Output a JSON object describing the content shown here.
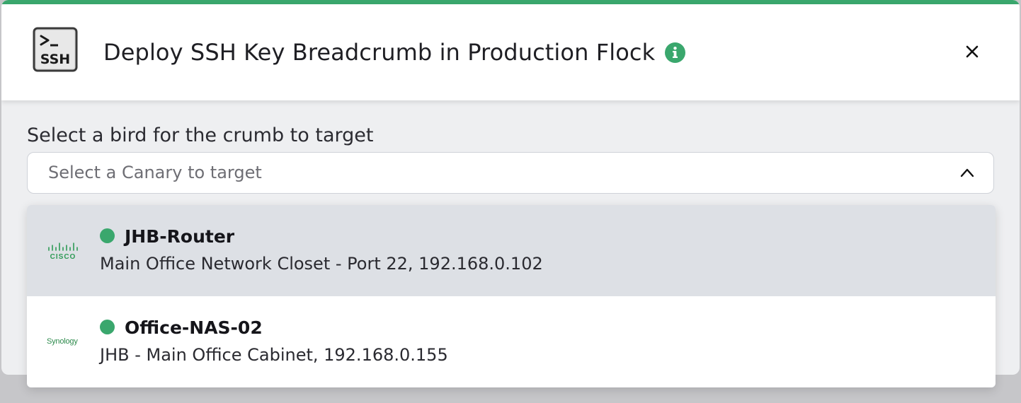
{
  "dialog": {
    "title": "Deploy SSH Key Breadcrumb in Production Flock",
    "logo_text": "SSH",
    "logo_prompt": ">_",
    "info_icon": "info-icon",
    "close_icon": "close-icon"
  },
  "form": {
    "label": "Select a bird for the crumb to target",
    "select": {
      "placeholder": "Select a Canary to target",
      "expanded": true,
      "chevron_icon": "chevron-up-icon"
    }
  },
  "options": [
    {
      "name": "JHB-Router",
      "detail": "Main Office Network Closet - Port 22, 192.168.0.102",
      "vendor": "CISCO",
      "vendor_icon": "cisco-logo",
      "status": "online",
      "highlighted": true
    },
    {
      "name": "Office-NAS-02",
      "detail": "JHB - Main Office Cabinet, 192.168.0.155",
      "vendor": "Synology",
      "vendor_icon": "synology-logo",
      "status": "online",
      "highlighted": false
    }
  ],
  "colors": {
    "accent": "#3aa76d",
    "highlight": "#dde0e5",
    "modal_bg": "#eeeff1",
    "backdrop": "#c6c6c9"
  }
}
